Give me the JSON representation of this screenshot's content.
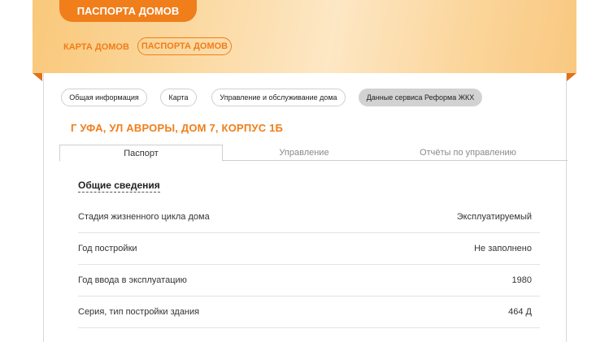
{
  "header": {
    "title": "ПАСПОРТА ДОМОВ",
    "nav": {
      "map_link": "КАРТА ДОМОВ",
      "passports_link": "ПАСПОРТА ДОМОВ"
    }
  },
  "chips": [
    {
      "label": "Общая информация"
    },
    {
      "label": "Карта"
    },
    {
      "label": "Управление и обслуживание дома"
    },
    {
      "label": "Данные сервиса Реформа ЖКХ",
      "active": true
    }
  ],
  "address": "Г УФА, УЛ АВРОРЫ, ДОМ 7, КОРПУС 1Б",
  "tabs": [
    {
      "label": "Паспорт",
      "active": true
    },
    {
      "label": "Управление"
    },
    {
      "label": "Отчёты по управлению"
    }
  ],
  "section": {
    "title": "Общие сведения",
    "rows": [
      {
        "label": "Стадия жизненного цикла дома",
        "value": "Эксплуатируемый"
      },
      {
        "label": "Год постройки",
        "value": "Не заполнено"
      },
      {
        "label": "Год ввода в эксплуатацию",
        "value": "1980"
      },
      {
        "label": "Серия, тип постройки здания",
        "value": "464 Д"
      }
    ]
  },
  "colors": {
    "accent": "#f07e1b",
    "header_gradient_start": "#f9c87a",
    "header_gradient_mid": "#fde7c4",
    "active_chip": "#d2d2d2"
  }
}
